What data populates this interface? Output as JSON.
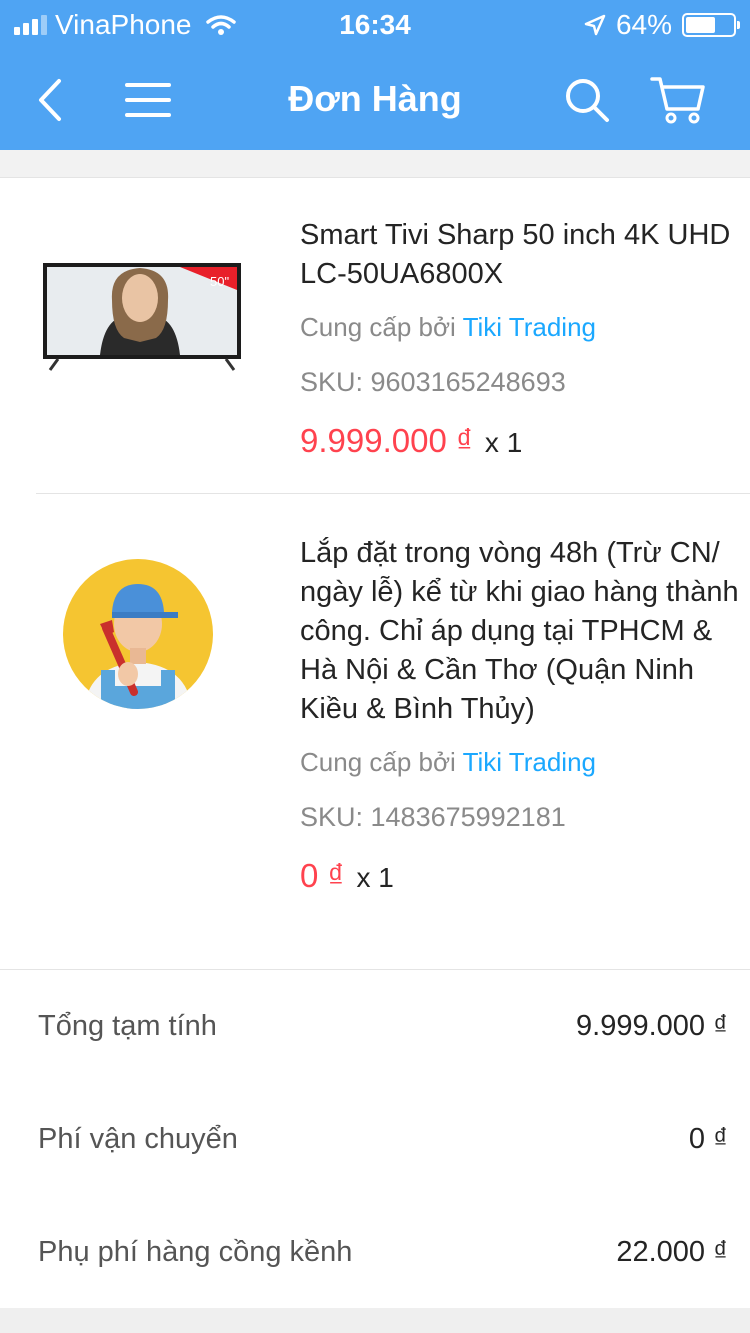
{
  "status_bar": {
    "carrier": "VinaPhone",
    "time": "16:34",
    "battery": "64%",
    "battery_level": 0.64
  },
  "header": {
    "title": "Đơn Hàng",
    "icons": [
      "back-icon",
      "menu-icon",
      "search-icon",
      "cart-icon"
    ]
  },
  "items": [
    {
      "name": "Smart Tivi Sharp 50 inch 4K UHD LC-50UA6800X",
      "provider_prefix": "Cung cấp bởi ",
      "provider": "Tiki Trading",
      "sku": "SKU: 9603165248693",
      "price": "9.999.000 ₫",
      "qty": "x 1",
      "badge": "50\""
    },
    {
      "name": "Lắp đặt trong vòng 48h (Trừ CN/ ngày lễ) kể từ khi giao hàng thành công. Chỉ áp dụng tại TPHCM & Hà Nội & Cần Thơ (Quận Ninh Kiều & Bình Thủy)",
      "provider_prefix": "Cung cấp bởi ",
      "provider": "Tiki Trading",
      "sku": "SKU: 1483675992181",
      "price": "0 ₫",
      "qty": "x 1"
    }
  ],
  "summary": [
    {
      "label": "Tổng tạm tính",
      "value": "9.999.000 ₫"
    },
    {
      "label": "Phí vận chuyển",
      "value": "0 ₫"
    },
    {
      "label": "Phụ phí hàng cồng kềnh",
      "value": "22.000 ₫"
    }
  ],
  "colors": {
    "header_bg": "#4fa4f3",
    "price_red": "#ff424e",
    "link_blue": "#1ba8ff"
  }
}
